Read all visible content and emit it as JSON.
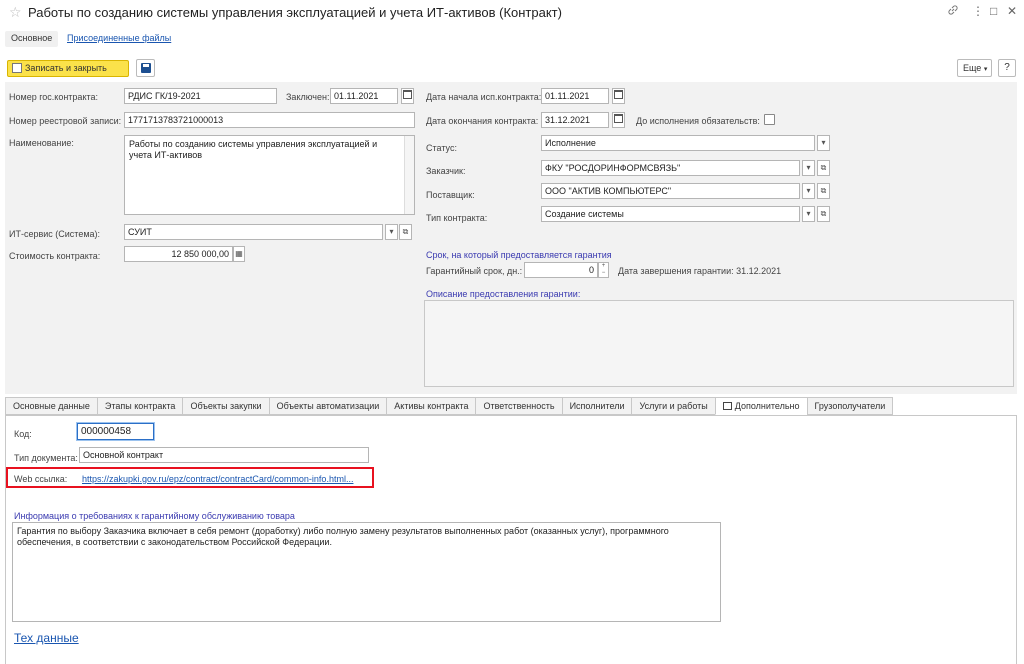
{
  "window": {
    "title": "Работы по созданию системы управления эксплуатацией и учета ИТ-активов  (Контракт)",
    "link_icon": "link-icon",
    "menu_icon": "more-vertical-icon",
    "maximize_icon": "□",
    "close_icon": "✕"
  },
  "nav_tabs": {
    "main": "Основное",
    "files": "Присоединенные файлы"
  },
  "toolbar": {
    "save_close": "Записать и закрыть",
    "save_icon": "floppy-icon",
    "more": "Еще",
    "more_arrow": "▾",
    "help": "?"
  },
  "form": {
    "gos_number_label": "Номер гос.контракта:",
    "gos_number": "РДИС ГК/19-2021",
    "concluded_label": "Заключен:",
    "concluded": "01.11.2021",
    "registry_label": "Номер реестровой записи:",
    "registry": "1771713783721000013",
    "name_label": "Наименование:",
    "name": "Работы по созданию системы управления эксплуатацией и учета ИТ-активов",
    "it_service_label": "ИТ-сервис (Система):",
    "it_service": "СУИТ",
    "cost_label": "Стоимость контракта:",
    "cost": "12 850 000,00",
    "start_label": "Дата начала исп.контракта:",
    "start": "01.11.2021",
    "end_label": "Дата окончания контракта:",
    "end": "31.12.2021",
    "until_label": "До исполнения обязательств:",
    "status_label": "Статус:",
    "status": "Исполнение",
    "customer_label": "Заказчик:",
    "customer": "ФКУ \"РОСДОРИНФОРМСВЯЗЬ\"",
    "supplier_label": "Поставщик:",
    "supplier": "ООО \"АКТИВ КОМПЬЮТЕРС\"",
    "contract_type_label": "Тип контракта:",
    "contract_type": "Создание системы",
    "warranty_group": "Срок, на который предоставляется гарантия",
    "warranty_days_label": "Гарантийный срок, дн.:",
    "warranty_days": "0",
    "warranty_end": "Дата завершения гарантии: 31.12.2021",
    "warranty_desc_label": "Описание предоставления гарантии:"
  },
  "tabs": [
    "Основные данные",
    "Этапы контракта",
    "Объекты закупки",
    "Объекты автоматизации",
    "Активы контракта",
    "Ответственность",
    "Исполнители",
    "Услуги и работы",
    "Дополнительно",
    "Грузополучатели"
  ],
  "extra": {
    "code_label": "Код:",
    "code": "000000458",
    "doc_type_label": "Тип документа:",
    "doc_type": "Основной контракт",
    "web_label": "Web ссылка:",
    "web_link": "https://zakupki.gov.ru/epz/contract/contractCard/common-info.html...",
    "requirements_label": "Информация о требованиях к гарантийному обслуживанию товара",
    "requirements": "Гарантия по выбору Заказчика включает в себя ремонт (доработку) либо полную замену результатов выполненных работ (оказанных услуг), программного обеспечения, в соответствии с законодательством Российской Федерации.",
    "tech_link": "Тех данные"
  },
  "colors": {
    "primary_button": "#fbe24a",
    "link": "#1a56b0",
    "highlight_box": "#e8111f",
    "group_title": "#3a3ab0"
  }
}
